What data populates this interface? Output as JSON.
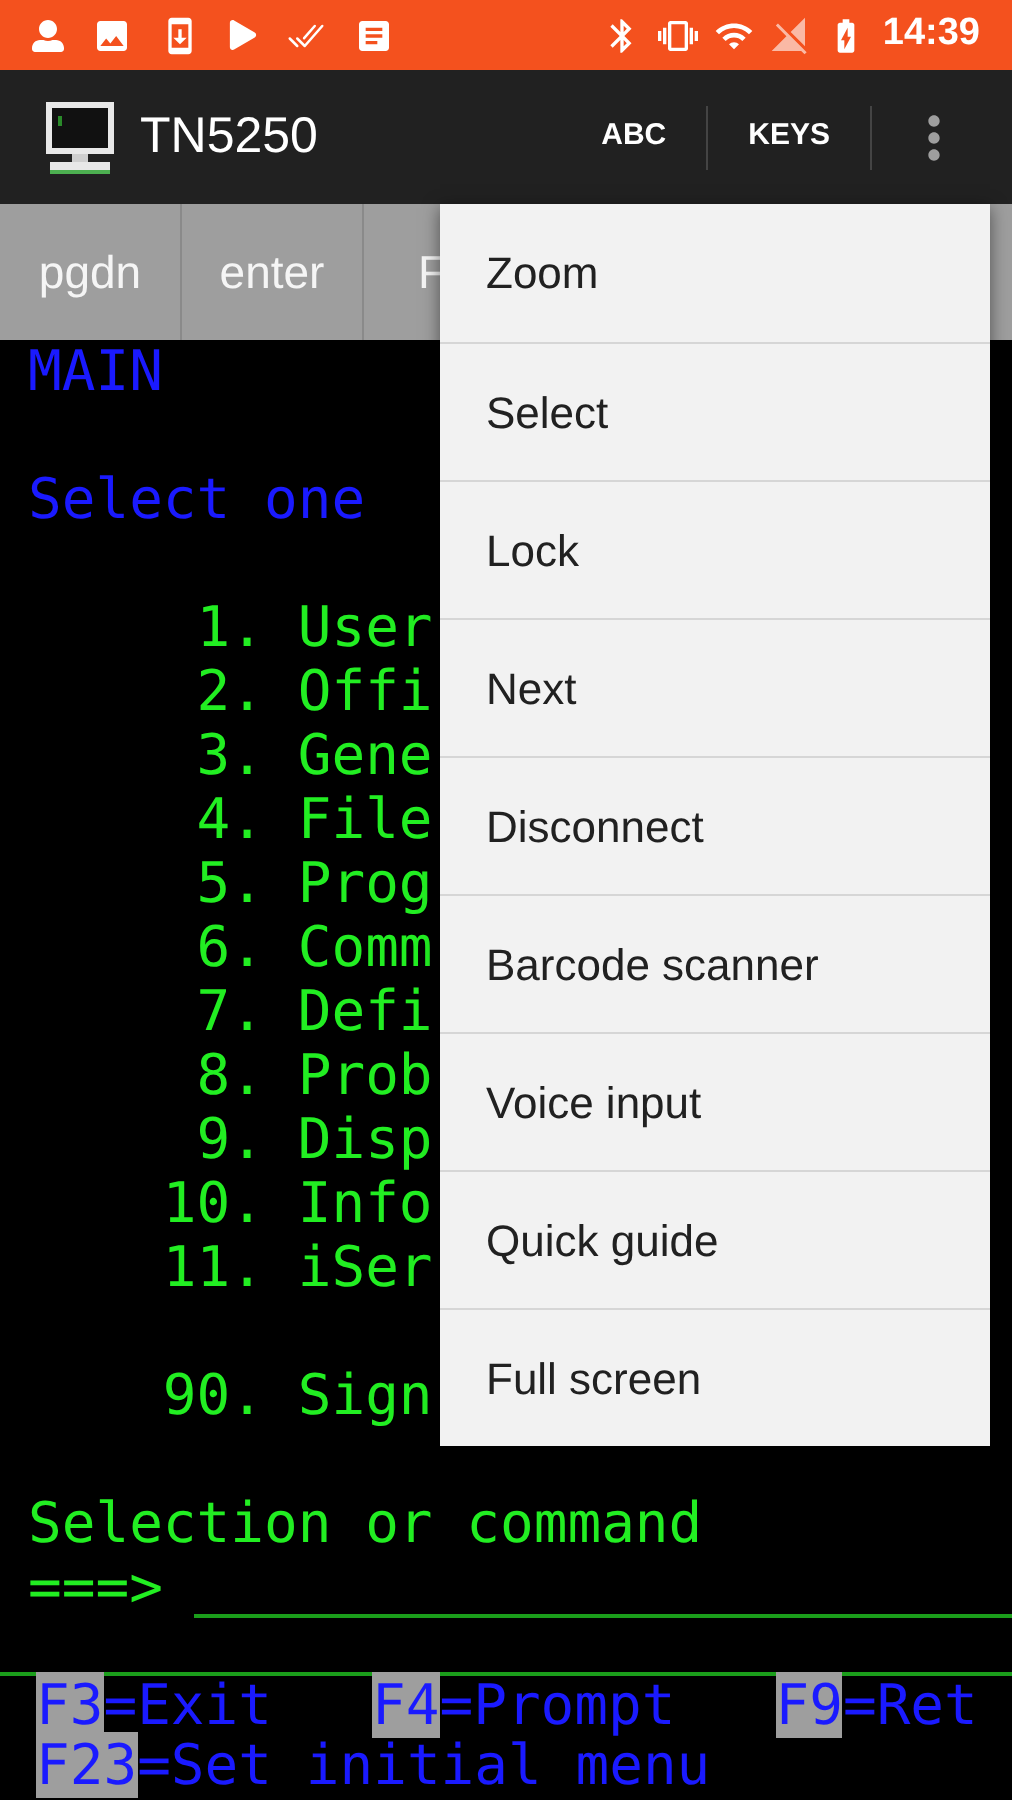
{
  "status_bar": {
    "time": "14:39"
  },
  "app_bar": {
    "title": "TN5250",
    "actions": [
      "ABC",
      "KEYS"
    ]
  },
  "key_bar": {
    "keys": [
      "pgdn",
      "enter",
      "F"
    ]
  },
  "terminal": {
    "title": "MAIN",
    "prompt": "Select one",
    "items": [
      {
        "number": "1.",
        "label": "User"
      },
      {
        "number": "2.",
        "label": "Offi"
      },
      {
        "number": "3.",
        "label": "Gene"
      },
      {
        "number": "4.",
        "label": "File"
      },
      {
        "number": "5.",
        "label": "Prog"
      },
      {
        "number": "6.",
        "label": "Comm"
      },
      {
        "number": "7.",
        "label": "Defi"
      },
      {
        "number": "8.",
        "label": "Prob"
      },
      {
        "number": "9.",
        "label": "Disp"
      },
      {
        "number": "10.",
        "label": "Info"
      },
      {
        "number": "11.",
        "label": "iSer"
      }
    ],
    "last_item": {
      "number": "90.",
      "label": "Sign"
    },
    "command_label": "Selection or command",
    "command_arrow": "===>",
    "function_keys": [
      {
        "key": "F3",
        "label": "=Exit"
      },
      {
        "key": "F4",
        "label": "=Prompt"
      },
      {
        "key": "F9",
        "label": "=Ret"
      }
    ],
    "function_keys_2": [
      {
        "key": "F23",
        "label": "=Set initial menu"
      }
    ]
  },
  "menu": {
    "items": [
      "Zoom",
      "Select",
      "Lock",
      "Next",
      "Disconnect",
      "Barcode scanner",
      "Voice input",
      "Quick guide",
      "Full screen"
    ]
  }
}
